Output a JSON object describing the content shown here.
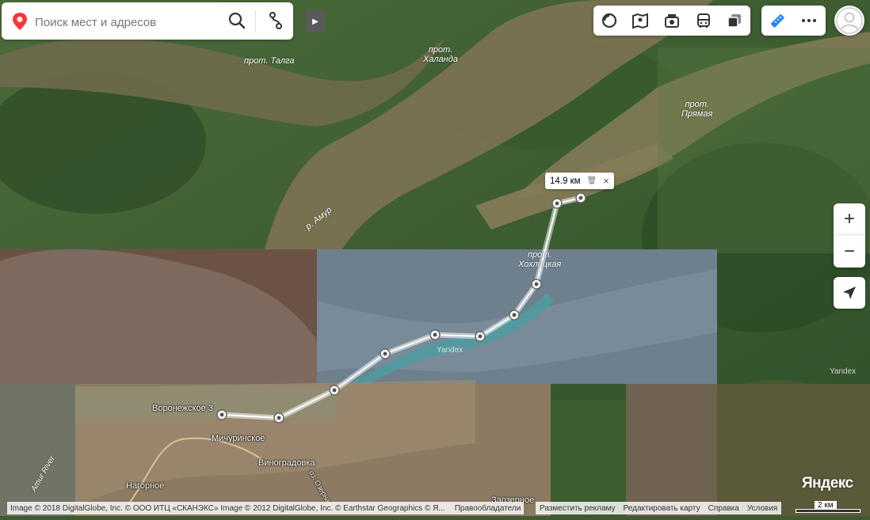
{
  "search": {
    "placeholder": "Поиск мест и адресов"
  },
  "ruler": {
    "distance": "14.9 км"
  },
  "map_labels": {
    "talga": "прот. Талга",
    "khalanda": "прот.\nХаланда",
    "pryamaya": "прот.\nПрямая",
    "amur": "р. Амур",
    "khokhlitskaya": "прот.\nХохлицкая",
    "amur_river": "Amur River",
    "yandex_wm1": "Yandex",
    "yandex_wm2": "Yandex"
  },
  "places": {
    "voronezhskoe": "Воронежское 3",
    "michurinskoe": "Мичуринское",
    "vinogradovka": "Виноградовка",
    "nagornoe": "Нагорное",
    "zaozernoe": "Заозерное",
    "ozernaya": "оз. Озерная"
  },
  "brand": "Яндекс",
  "copyright": "Image © 2018 DigitalGlobe, Inc. © ООО ИТЦ «СКАНЭКС» Image © 2012 DigitalGlobe, Inc. © Earthstar Geographics © Я...",
  "copyright_link": "Правообладатели",
  "footer": {
    "advertise": "Разместить рекламу",
    "edit_map": "Редактировать карту",
    "help": "Справка",
    "terms": "Условия"
  },
  "scale": "2 км",
  "colors": {
    "accent": "#1e88ff",
    "pin": "#f33",
    "route": "#ffffff"
  }
}
